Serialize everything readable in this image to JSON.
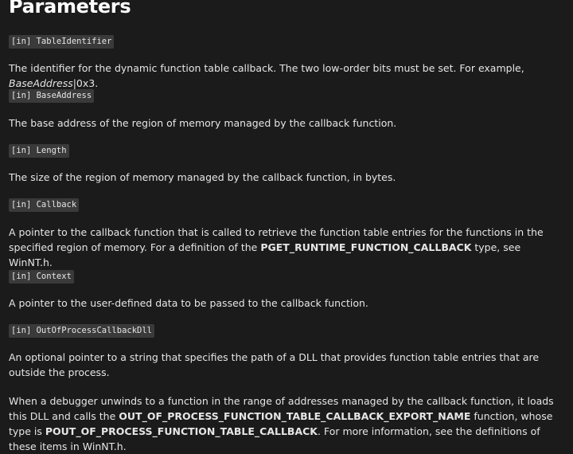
{
  "heading": "Parameters",
  "params": [
    {
      "label": "[in] TableIdentifier",
      "desc_before": "The identifier for the dynamic function table callback. The two low-order bits must be set. For example, ",
      "desc_em": "BaseAddress",
      "desc_after": "|0x3."
    },
    {
      "label": "[in] BaseAddress",
      "desc": "The base address of the region of memory managed by the callback function."
    },
    {
      "label": "[in] Length",
      "desc": "The size of the region of memory managed by the callback function, in bytes."
    },
    {
      "label": "[in] Callback",
      "desc_before": "A pointer to the callback function that is called to retrieve the function table entries for the functions in the specified region of memory. For a definition of the ",
      "desc_bold": "PGET_RUNTIME_FUNCTION_CALLBACK",
      "desc_after": " type, see WinNT.h."
    },
    {
      "label": "[in] Context",
      "desc": "A pointer to the user-defined data to be passed to the callback function."
    },
    {
      "label": "[in] OutOfProcessCallbackDll",
      "desc": "An optional pointer to a string that specifies the path of a DLL that provides function table entries that are outside the process."
    }
  ],
  "note": {
    "part1": "When a debugger unwinds to a function in the range of addresses managed by the callback function, it loads this DLL and calls the ",
    "bold1": "OUT_OF_PROCESS_FUNCTION_TABLE_CALLBACK_EXPORT_NAME",
    "part2": " function, whose type is ",
    "bold2": "POUT_OF_PROCESS_FUNCTION_TABLE_CALLBACK",
    "part3": ". For more information, see the definitions of these items in WinNT.h."
  }
}
